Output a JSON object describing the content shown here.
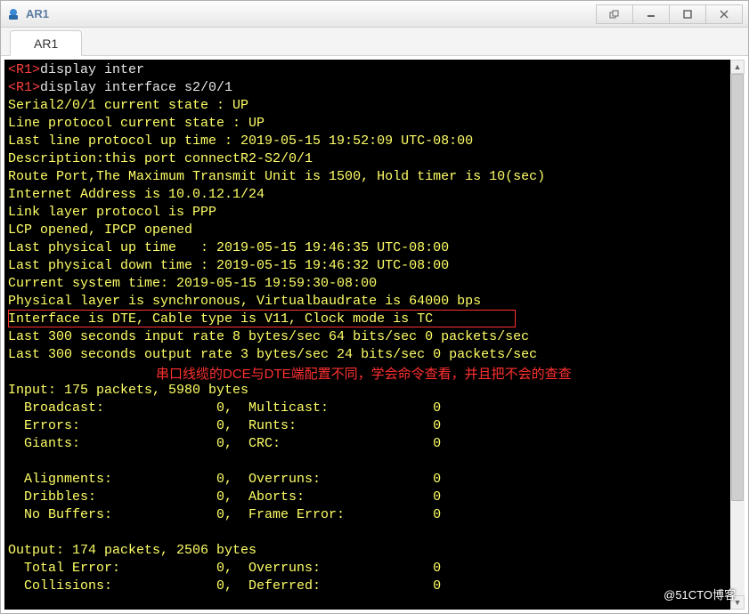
{
  "window": {
    "title": "AR1"
  },
  "tabs": [
    {
      "label": "AR1"
    }
  ],
  "terminal": {
    "prompt1": "<R1>",
    "cmd1": "display inter",
    "prompt2": "<R1>",
    "cmd2": "display interface s2/0/1",
    "lines": {
      "l0": "Serial2/0/1 current state : UP",
      "l1": "Line protocol current state : UP",
      "l2": "Last line protocol up time : 2019-05-15 19:52:09 UTC-08:00",
      "l3": "Description:this port connectR2-S2/0/1",
      "l4": "Route Port,The Maximum Transmit Unit is 1500, Hold timer is 10(sec)",
      "l5": "Internet Address is 10.0.12.1/24",
      "l6": "Link layer protocol is PPP",
      "l7": "LCP opened, IPCP opened",
      "l8": "Last physical up time   : 2019-05-15 19:46:35 UTC-08:00",
      "l9": "Last physical down time : 2019-05-15 19:46:32 UTC-08:00",
      "l10": "Current system time: 2019-05-15 19:59:30-08:00",
      "l11": "Physical layer is synchronous, Virtualbaudrate is 64000 bps",
      "l12": "Interface is DTE, Cable type is V11, Clock mode is TC",
      "l13": "Last 300 seconds input rate 8 bytes/sec 64 bits/sec 0 packets/sec",
      "l14": "Last 300 seconds output rate 3 bytes/sec 24 bits/sec 0 packets/sec",
      "l15": "",
      "l16": "Input: 175 packets, 5980 bytes",
      "l17": "  Broadcast:              0,  Multicast:             0",
      "l18": "  Errors:                 0,  Runts:                 0",
      "l19": "  Giants:                 0,  CRC:                   0",
      "l20": "",
      "l21": "  Alignments:             0,  Overruns:              0",
      "l22": "  Dribbles:               0,  Aborts:                0",
      "l23": "  No Buffers:             0,  Frame Error:           0",
      "l24": "",
      "l25": "Output: 174 packets, 2506 bytes",
      "l26": "  Total Error:            0,  Overruns:              0",
      "l27": "  Collisions:             0,  Deferred:              0"
    }
  },
  "annotation": "串口线缆的DCE与DTE端配置不同，学会命令查看，并且把不会的查查",
  "watermark": "@51CTO博客"
}
